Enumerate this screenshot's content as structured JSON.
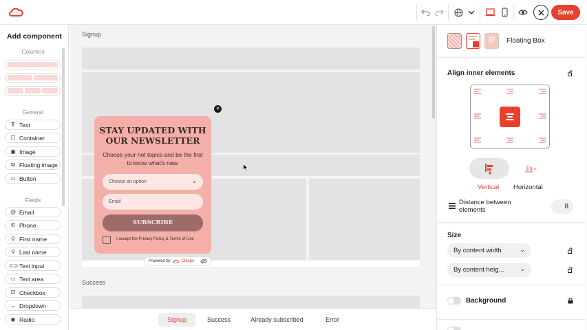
{
  "topbar": {
    "save_label": "Save",
    "accent": "#e8402f"
  },
  "left_panel": {
    "title": "Add component",
    "sections": {
      "columns": "Columns",
      "general": "General",
      "fields": "Fields"
    },
    "general_items": [
      {
        "label": "Text",
        "icon": "text-icon"
      },
      {
        "label": "Container",
        "icon": "container-icon"
      },
      {
        "label": "Image",
        "icon": "image-icon"
      },
      {
        "label": "Floating image",
        "icon": "floating-image-icon"
      },
      {
        "label": "Button",
        "icon": "button-icon"
      }
    ],
    "field_items": [
      {
        "label": "Email",
        "icon": "at-icon"
      },
      {
        "label": "Phone",
        "icon": "phone-icon"
      },
      {
        "label": "First name",
        "icon": "person-icon"
      },
      {
        "label": "Last name",
        "icon": "person-icon"
      },
      {
        "label": "Text input",
        "icon": "input-icon"
      },
      {
        "label": "Text area",
        "icon": "textarea-icon"
      },
      {
        "label": "Checkbox",
        "icon": "checkbox-icon"
      },
      {
        "label": "Dropdown",
        "icon": "dropdown-icon"
      },
      {
        "label": "Radio",
        "icon": "radio-icon"
      }
    ]
  },
  "canvas": {
    "signup_label": "Signup",
    "success_label": "Success",
    "popup": {
      "title": "STAY UPDATED WITH OUR NEWSLETTER",
      "subtitle": "Choose your hot topics and be the first to know what's new.",
      "select_placeholder": "Choose an option",
      "email_placeholder": "Email",
      "button_label": "SUBSCRIBE",
      "checkbox_label": "I accept the Privacy Policy & Terms of Use",
      "bg_color": "#f4b0a8"
    },
    "powered_by": {
      "prefix": "Powered by",
      "brand": "Claspo"
    }
  },
  "tabs": [
    {
      "label": "Signup",
      "active": true
    },
    {
      "label": "Success",
      "active": false
    },
    {
      "label": "Already subscribed",
      "active": false
    },
    {
      "label": "Error",
      "active": false
    }
  ],
  "right_panel": {
    "element_title": "Floating Box",
    "align_title": "Align inner elements",
    "vertical_label": "Vertical",
    "horizontal_label": "Horizontal",
    "distance_label": "Distance between elements",
    "distance_value": "8",
    "size_title": "Size",
    "width_value": "By content width",
    "height_value": "By content heig...",
    "background_label": "Background"
  }
}
